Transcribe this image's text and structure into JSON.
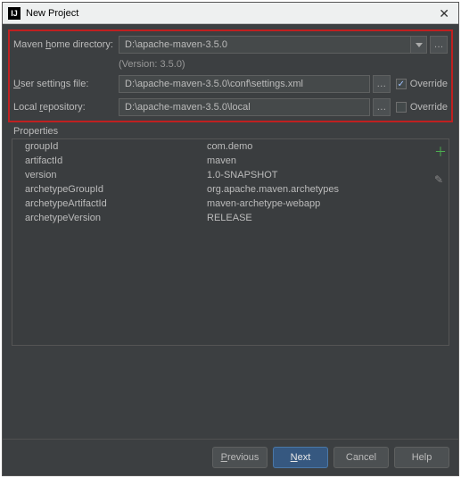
{
  "window": {
    "title": "New Project"
  },
  "form": {
    "maven_home": {
      "label_pre": "Maven ",
      "label_ul": "h",
      "label_post": "ome directory:",
      "value": "D:\\apache-maven-3.5.0"
    },
    "version_text": "(Version: 3.5.0)",
    "user_settings": {
      "label_pre": "",
      "label_ul": "U",
      "label_post": "ser settings file:",
      "value": "D:\\apache-maven-3.5.0\\conf\\settings.xml",
      "override_label_pre": "Over",
      "override_label_ul": "r",
      "override_label_post": "ide",
      "override_checked": true
    },
    "local_repo": {
      "label_pre": "Local ",
      "label_ul": "r",
      "label_post": "epository:",
      "value": "D:\\apache-maven-3.5.0\\local",
      "override_label": "Override",
      "override_checked": false
    }
  },
  "properties_title": "Properties",
  "properties": [
    {
      "key": "groupId",
      "value": "com.demo"
    },
    {
      "key": "artifactId",
      "value": "maven"
    },
    {
      "key": "version",
      "value": "1.0-SNAPSHOT"
    },
    {
      "key": "archetypeGroupId",
      "value": "org.apache.maven.archetypes"
    },
    {
      "key": "archetypeArtifactId",
      "value": "maven-archetype-webapp"
    },
    {
      "key": "archetypeVersion",
      "value": "RELEASE"
    }
  ],
  "buttons": {
    "previous_pre": "",
    "previous_ul": "P",
    "previous_post": "revious",
    "next_pre": "",
    "next_ul": "N",
    "next_post": "ext",
    "cancel": "Cancel",
    "help": "Help"
  }
}
